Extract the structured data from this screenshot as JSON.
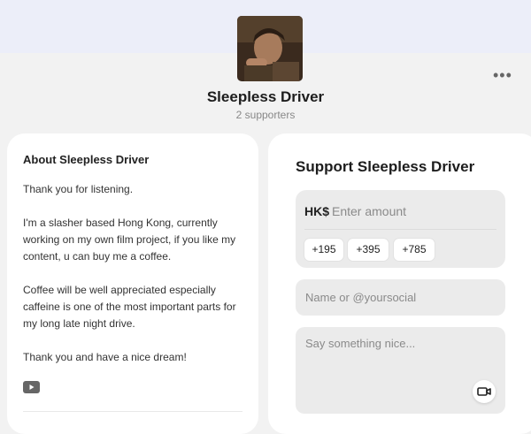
{
  "creator": {
    "name": "Sleepless Driver",
    "supporters": "2 supporters"
  },
  "menu": {
    "more_label": "•••"
  },
  "about": {
    "title": "About Sleepless Driver",
    "paragraphs": [
      "Thank you for listening.",
      "I'm a slasher based Hong Kong, currently working on my own film project, if you like my content, u can buy me a coffee.",
      "Coffee will be well appreciated especially caffeine is one of the most important parts for my long late night drive.",
      "Thank you and have a nice dream!"
    ],
    "social_icon": "youtube-icon"
  },
  "support": {
    "title": "Support Sleepless Driver",
    "currency": "HK$",
    "amount_placeholder": "Enter amount",
    "presets": [
      "+195",
      "+395",
      "+785"
    ],
    "name_placeholder": "Name or @yoursocial",
    "message_placeholder": "Say something nice...",
    "video_icon": "video-camera-icon"
  }
}
